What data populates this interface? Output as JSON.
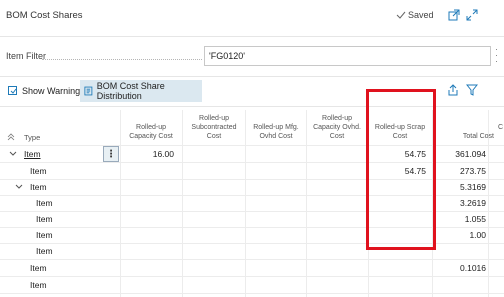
{
  "window": {
    "title": "BOM Cost Shares",
    "status": "Saved"
  },
  "filter": {
    "label": "Item Filter",
    "value": "'FG0120'"
  },
  "actions": {
    "show_warnings": "Show Warnings",
    "distribution": "BOM Cost Share Distribution"
  },
  "columns": {
    "type": "Type",
    "capacity": [
      "Rolled-up",
      "Capacity Cost"
    ],
    "subcontracted": [
      "Rolled-up",
      "Subcontracted",
      "Cost"
    ],
    "mfg_ovhd": [
      "Rolled-up Mfg.",
      "Ovhd Cost"
    ],
    "capacity_ovhd": [
      "Rolled-up",
      "Capacity Ovhd.",
      "Cost"
    ],
    "scrap": [
      "Rolled-up Scrap",
      "Cost"
    ],
    "total": "Total Cost"
  },
  "rows": [
    {
      "type": "Item",
      "capacity": "16.00",
      "scrap": "54.75",
      "total": "361.094"
    },
    {
      "type": "Item",
      "capacity": "",
      "scrap": "54.75",
      "total": "273.75"
    },
    {
      "type": "Item",
      "capacity": "",
      "scrap": "",
      "total": "5.3169"
    },
    {
      "type": "Item",
      "capacity": "",
      "scrap": "",
      "total": "3.2619"
    },
    {
      "type": "Item",
      "capacity": "",
      "scrap": "",
      "total": "1.055"
    },
    {
      "type": "Item",
      "capacity": "",
      "scrap": "",
      "total": "1.00"
    },
    {
      "type": "Item",
      "capacity": "",
      "scrap": "",
      "total": ""
    },
    {
      "type": "Item",
      "capacity": "",
      "scrap": "",
      "total": "0.1016"
    },
    {
      "type": "Item",
      "capacity": "",
      "scrap": "",
      "total": ""
    }
  ],
  "colors": {
    "highlight": "#e0121e",
    "accent": "#1e7ab8",
    "active_action_bg": "#dbe8f0"
  }
}
